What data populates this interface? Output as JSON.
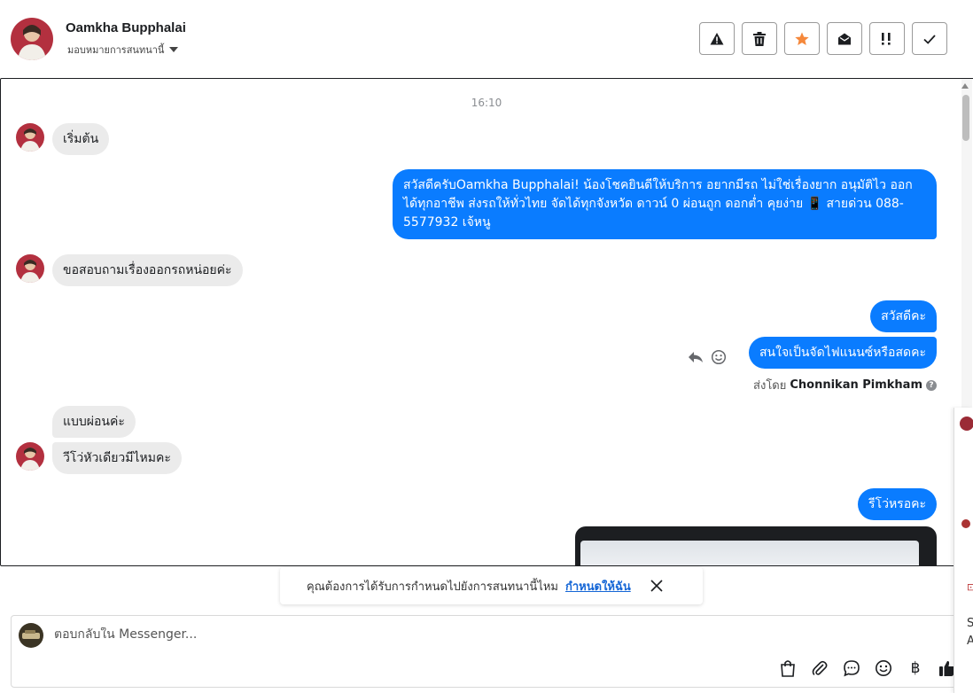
{
  "header": {
    "contact_name": "Oamkha Bupphalai",
    "assign_label": "มอบหมายการสนทนานี้",
    "actions": [
      {
        "icon": "warning-icon",
        "label": "Report spam"
      },
      {
        "icon": "trash-icon",
        "label": "Delete"
      },
      {
        "icon": "star-icon",
        "label": "Follow up"
      },
      {
        "icon": "envelope-open-icon",
        "label": "Mark as unread"
      },
      {
        "icon": "priority-icon",
        "label": "Mark as priority"
      },
      {
        "icon": "check-icon",
        "label": "Mark as done"
      }
    ],
    "accent_star": "#f5883b"
  },
  "chat": {
    "timestamp": "16:10",
    "messages": [
      {
        "dir": "in",
        "text": "เริ่มต้น"
      },
      {
        "dir": "out",
        "text": "สวัสดีครับOamkha Bupphalai! น้องโชคยินดีให้บริการ อยากมีรถ ไม่ใช่เรื่องยาก อนุมัติไว ออกได้ทุกอาชีพ ส่งรถให้ทั่วไทย จัดได้ทุกจังหวัด ดาวน์ 0  ผ่อนถูก ดอกต่ำ คุยง่าย 📱 สายด่วน 088- 5577932 เจ้หนู"
      },
      {
        "dir": "in",
        "text": "ขอสอบถามเรื่องออกรถหน่อยค่ะ"
      },
      {
        "dir": "out",
        "text": "สวัสดีคะ"
      },
      {
        "dir": "out",
        "text": "สนใจเป็นจัดไฟแนนซ์หรือสดคะ"
      },
      {
        "dir": "in",
        "text": "แบบผ่อนค่ะ"
      },
      {
        "dir": "in",
        "text": "วีโว่หัวเดียวมีไหมคะ"
      },
      {
        "dir": "out",
        "text": "รีโว่หรอคะ"
      }
    ],
    "sent_by_prefix": "ส่งโดย",
    "sent_by_name": "Chonnikan Pimkham",
    "bubble_out_color": "#0a7cff",
    "bubble_in_color": "#ebebeb"
  },
  "followup": {
    "text": "คุณต้องการได้รับการกำหนดไปยังการสนทนานี้ไหม",
    "link": "กำหนดให้ฉัน"
  },
  "reply": {
    "placeholder": "ตอบกลับใน Messenger...",
    "tools": [
      "shopping-bag-icon",
      "paperclip-icon",
      "chat-bubble-icon",
      "emoji-icon",
      "baht-icon",
      "thumbs-up-icon"
    ]
  },
  "side_widget": {
    "text_lines": [
      "S",
      "A"
    ]
  }
}
